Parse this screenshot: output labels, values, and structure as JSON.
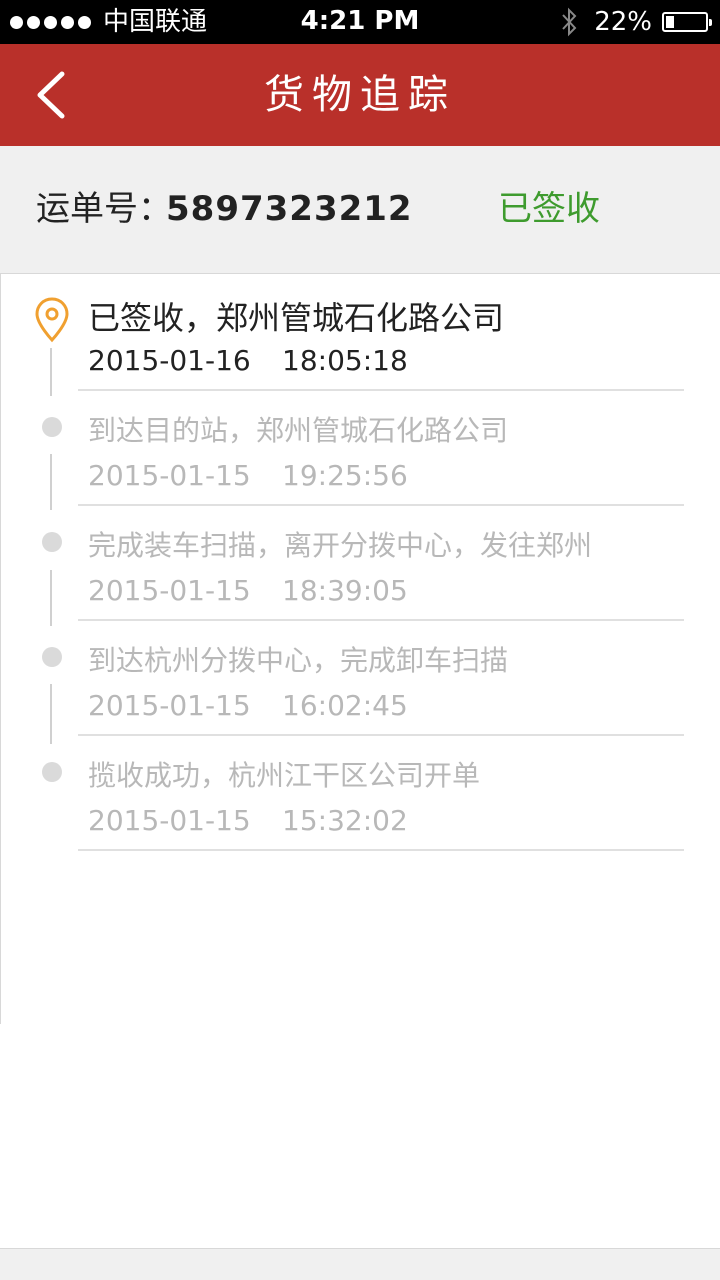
{
  "status_bar": {
    "carrier": "中国联通",
    "time": "4:21 PM",
    "battery_percent": "22%",
    "battery_level": 0.22,
    "signal_dots": 5
  },
  "nav": {
    "title": "货物追踪",
    "back_icon": "chevron-left-icon"
  },
  "waybill": {
    "label": "运单号：",
    "number": "5897323212",
    "status": "已签收",
    "status_color": "#3e9b2e"
  },
  "tracking": [
    {
      "description": "已签收，郑州管城石化路公司",
      "date": "2015-01-16",
      "time": "18:05:18",
      "current": true
    },
    {
      "description": "到达目的站，郑州管城石化路公司",
      "date": "2015-01-15",
      "time": "19:25:56",
      "current": false
    },
    {
      "description": "完成装车扫描，离开分拨中心，发往郑州",
      "date": "2015-01-15",
      "time": "18:39:05",
      "current": false
    },
    {
      "description": "到达杭州分拨中心，完成卸车扫描",
      "date": "2015-01-15",
      "time": "16:02:45",
      "current": false
    },
    {
      "description": "揽收成功，杭州江干区公司开单",
      "date": "2015-01-15",
      "time": "15:32:02",
      "current": false
    }
  ],
  "colors": {
    "nav_bg": "#b9302a",
    "pin": "#f0a030",
    "inactive_text": "#b8b8b8"
  }
}
